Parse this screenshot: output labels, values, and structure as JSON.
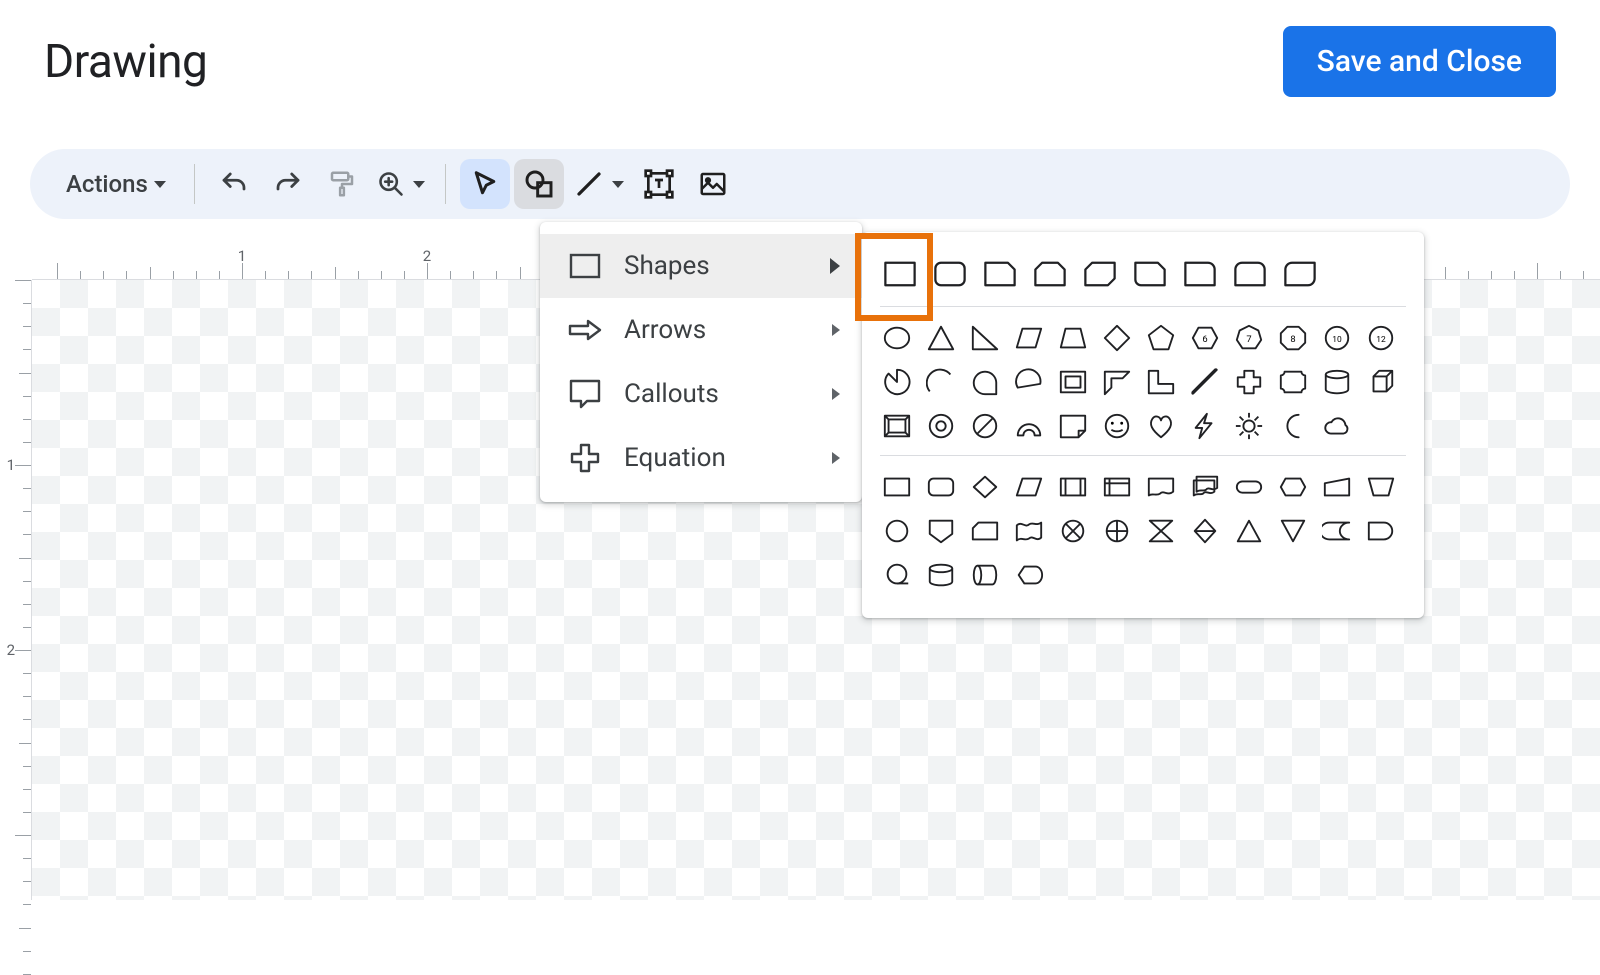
{
  "window_title": "Drawing",
  "save_button": "Save and Close",
  "toolbar": {
    "actions_label": "Actions"
  },
  "ruler": {
    "h_labels": [
      "1",
      "2"
    ],
    "v_labels": [
      "1",
      "2"
    ]
  },
  "shape_menu": {
    "items": [
      {
        "label": "Shapes",
        "icon": "rectangle-outline-icon",
        "selected": true
      },
      {
        "label": "Arrows",
        "icon": "arrow-right-icon",
        "selected": false
      },
      {
        "label": "Callouts",
        "icon": "speech-bubble-icon",
        "selected": false
      },
      {
        "label": "Equation",
        "icon": "plus-outline-icon",
        "selected": false
      }
    ]
  },
  "shapes_palette": {
    "highlighted_index": 0,
    "row1": [
      "rectangle",
      "rounded-rectangle",
      "snip-single-corner",
      "snip-same-side",
      "snip-diagonal",
      "snip-round-single",
      "round-single-corner",
      "round-same-side",
      "round-diagonal"
    ],
    "group2": [
      "oval",
      "triangle",
      "right-triangle",
      "parallelogram",
      "trapezoid",
      "diamond",
      "pentagon",
      "hexagon",
      "heptagon",
      "octagon",
      "decagon",
      "dodecagon",
      "pie",
      "arc",
      "teardrop",
      "chord",
      "frame",
      "half-frame",
      "l-shape",
      "diagonal-stripe",
      "cross",
      "plaque",
      "can",
      "cube",
      "bevel",
      "donut",
      "no-symbol",
      "block-arc",
      "folded-corner",
      "smiley",
      "heart",
      "lightning",
      "sun",
      "moon",
      "cloud"
    ],
    "group3": [
      "flow-process",
      "flow-alt-process",
      "flow-decision",
      "flow-data",
      "flow-predefined",
      "flow-internal-storage",
      "flow-document",
      "flow-multidocument",
      "flow-terminator",
      "flow-preparation",
      "flow-manual-input",
      "flow-manual-operation",
      "flow-connector",
      "flow-offpage",
      "flow-card",
      "flow-punched-tape",
      "flow-summing",
      "flow-or",
      "flow-collate",
      "flow-sort",
      "flow-extract",
      "flow-merge",
      "flow-stored-data",
      "flow-delay",
      "flow-seq-access",
      "flow-magnetic-disk",
      "flow-direct-access",
      "flow-display"
    ]
  }
}
